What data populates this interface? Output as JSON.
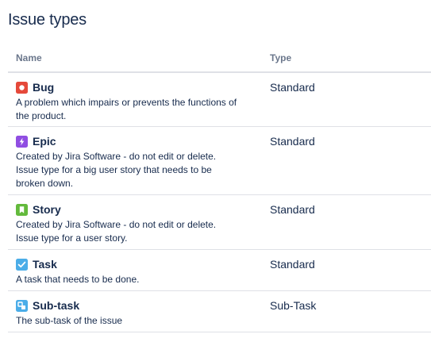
{
  "page": {
    "title": "Issue types"
  },
  "table": {
    "headers": {
      "name": "Name",
      "type": "Type"
    },
    "rows": [
      {
        "name": "Bug",
        "icon": "bug-icon",
        "icon_color": "#e5493a",
        "description_lines": [
          "A problem which impairs or prevents the functions of",
          "the product."
        ],
        "type": "Standard"
      },
      {
        "name": "Epic",
        "icon": "epic-lightning-icon",
        "icon_color": "#904ee2",
        "description_lines": [
          "Created by Jira Software - do not edit or delete.",
          "Issue type for a big user story that needs to be",
          "broken down."
        ],
        "type": "Standard"
      },
      {
        "name": "Story",
        "icon": "story-bookmark-icon",
        "icon_color": "#63ba3c",
        "description_lines": [
          "Created by Jira Software - do not edit or delete.",
          "Issue type for a user story."
        ],
        "type": "Standard"
      },
      {
        "name": "Task",
        "icon": "task-checkmark-icon",
        "icon_color": "#4bade8",
        "description_lines": [
          "A task that needs to be done."
        ],
        "type": "Standard"
      },
      {
        "name": "Sub-task",
        "icon": "subtask-icon",
        "icon_color": "#4bade8",
        "description_lines": [
          "The sub-task of the issue"
        ],
        "type": "Sub-Task"
      }
    ]
  }
}
